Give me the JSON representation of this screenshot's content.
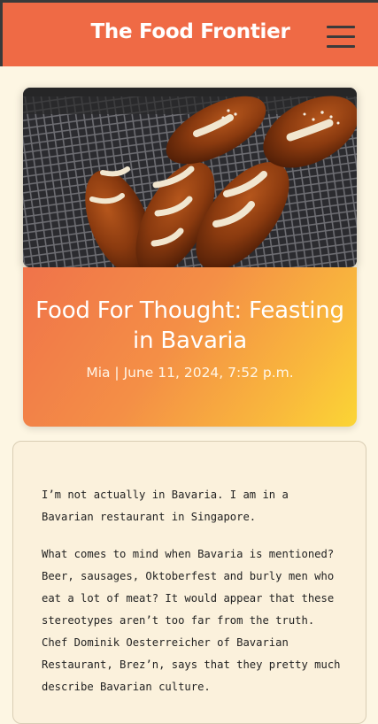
{
  "header": {
    "site_title": "The Food Frontier",
    "menu_icon": "hamburger-menu-icon"
  },
  "hero": {
    "image_subject": "bavarian-pretzel-rolls-on-cooling-rack"
  },
  "post": {
    "title": "Food For Thought: Feasting in Bavaria",
    "meta": "Mia | June 11, 2024, 7:52 p.m."
  },
  "article": {
    "paragraphs": [
      "I’m not actually in Bavaria. I am in a Bavarian restaurant in Singapore.",
      "What comes to mind when Bavaria is mentioned? Beer, sausages, Oktoberfest and burly men who eat a lot of meat? It would appear that these stereotypes aren’t too far from the truth. Chef Dominik Oesterreicher of Bavarian Restaurant, Brez’n, says that they pretty much describe Bavarian culture."
    ]
  },
  "colors": {
    "header_bg": "#ef6a45",
    "page_bg": "#fdf6e3",
    "card_gradient_start": "#f0734a",
    "card_gradient_end": "#fbd535"
  }
}
